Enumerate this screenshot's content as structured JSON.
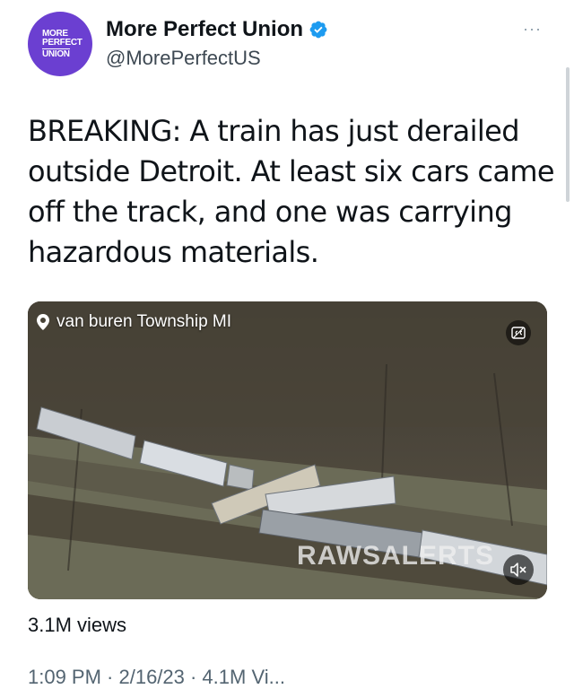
{
  "profile": {
    "avatar_lines": [
      "MORE",
      "PERFECT",
      "UNION"
    ],
    "name": "More Perfect Union",
    "handle": "@MorePerfectUS",
    "verified": true,
    "more_label": "···"
  },
  "tweet": {
    "text": "BREAKING: A train has just derailed outside Detroit. At least six cars came off the track, and one was carrying hazardous materials."
  },
  "media": {
    "location": "van buren Township MI",
    "watermark": "RAWSALERTS",
    "cc_icon": "closed-captions-icon",
    "mute_icon": "speaker-muted-icon"
  },
  "stats": {
    "views": "3.1M views"
  },
  "timestamp": "1:09 PM · 2/16/23 · 4.1M Vi..."
}
